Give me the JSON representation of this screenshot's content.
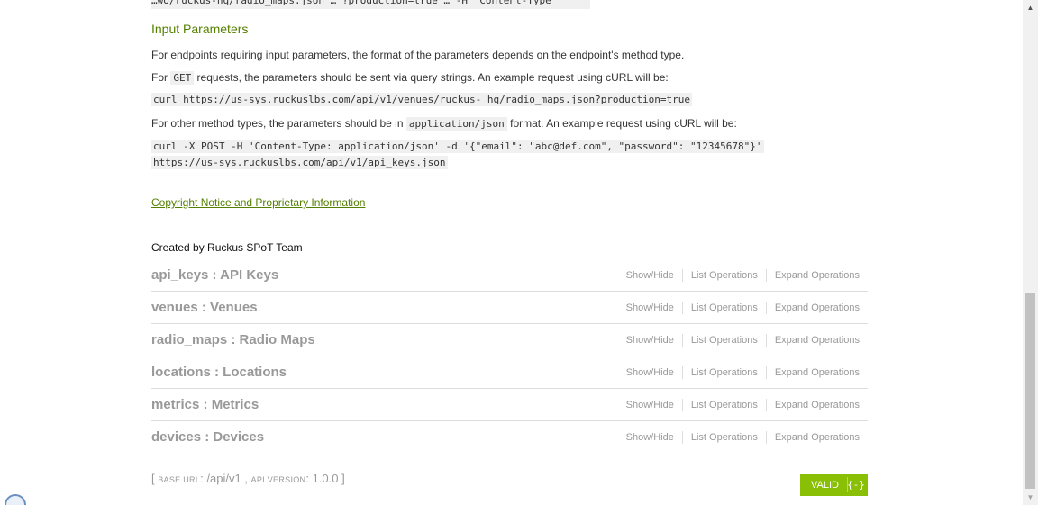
{
  "top_clipped_code": "…wo/ruckus-hq/radio_maps.json … ?production=true … -H 'Content-Type'",
  "input_params": {
    "heading": "Input Parameters",
    "intro": "For endpoints requiring input parameters, the format of the parameters depends on the endpoint's method type.",
    "get_prefix": "For ",
    "get_code": "GET",
    "get_suffix": " requests, the parameters should be sent via query strings. An example request using cURL will be:",
    "get_example": "curl https://us-sys.ruckuslbs.com/api/v1/venues/ruckus- hq/radio_maps.json?production=true",
    "other_prefix": "For other method types, the parameters should be in ",
    "other_code": "application/json",
    "other_suffix": " format. An example request using cURL will be:",
    "post_example_line1": "curl -X POST -H 'Content-Type: application/json' -d '{\"email\": \"abc@def.com\", \"password\": \"12345678\"}'",
    "post_example_line2": "https://us-sys.ruckuslbs.com/api/v1/api_keys.json"
  },
  "copyright_link": "Copyright Notice and Proprietary Information",
  "created_by": "Created by Ruckus SPoT Team",
  "operations": {
    "show_hide": "Show/Hide",
    "list": "List Operations",
    "expand": "Expand Operations"
  },
  "resources": [
    {
      "title": "api_keys : API Keys"
    },
    {
      "title": "venues : Venues"
    },
    {
      "title": "radio_maps : Radio Maps"
    },
    {
      "title": "locations : Locations"
    },
    {
      "title": "metrics : Metrics"
    },
    {
      "title": "devices : Devices"
    }
  ],
  "footer": {
    "open_bracket": "[ ",
    "base_url_label": "BASE URL",
    "base_url_value": ": /api/v1 , ",
    "api_version_label": "API VERSION",
    "api_version_value": ": 1.0.0 ]"
  },
  "validator": {
    "label": "VALID",
    "brace": "{-}"
  },
  "colors": {
    "accent_green": "#547f00",
    "valid_green": "#89bf04",
    "muted_gray": "#999999"
  }
}
